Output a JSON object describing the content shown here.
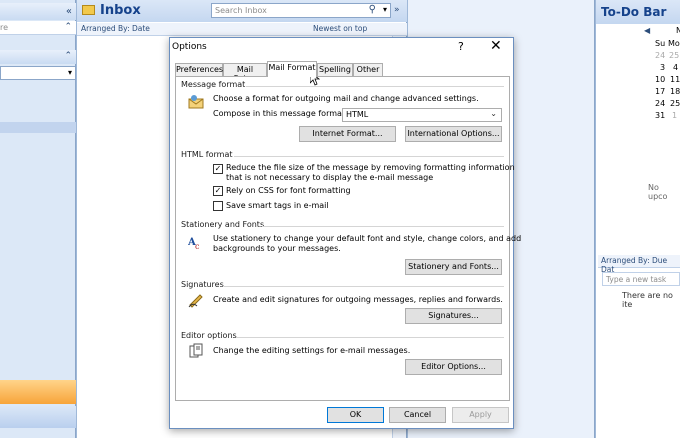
{
  "nav": {
    "collapse_glyph": "«",
    "row1_text": "re",
    "row1_chevron": "⌃",
    "row2_chevron": "⌃",
    "dropdown_arrow": "▾"
  },
  "inbox": {
    "title": "Inbox",
    "search_placeholder": "Search Inbox",
    "search_icon": "⚲",
    "search_dd": "▾",
    "expand": "»",
    "arranged_by": "Arranged By: Date",
    "sort_order": "Newest on top",
    "scroll_up": "▲"
  },
  "todo": {
    "title": "To-Do Bar",
    "prev": "◀",
    "month_label": "N",
    "weekday_headers": [
      "Su",
      "Mo"
    ],
    "calendar_rows": [
      [
        "24",
        "25"
      ],
      [
        "3",
        "4"
      ],
      [
        "10",
        "11"
      ],
      [
        "17",
        "18"
      ],
      [
        "24",
        "25"
      ],
      [
        "31",
        "1"
      ]
    ],
    "no_upcoming": "No upco",
    "arranged_by": "Arranged By: Due Dat",
    "new_task_placeholder": "Type a new task",
    "no_items": "There are no ite"
  },
  "dialog": {
    "title": "Options",
    "help_glyph": "?",
    "close_glyph": "✕",
    "tabs": [
      "Preferences",
      "Mail Setup",
      "Mail Format",
      "Spelling",
      "Other"
    ],
    "active_tab": "Mail Format",
    "sections": {
      "message_format": {
        "title": "Message format",
        "description": "Choose a format for outgoing mail and change advanced settings.",
        "compose_label": "Compose in this message format:",
        "compose_value": "HTML",
        "internet_format_button": "Internet Format...",
        "international_options_button": "International Options..."
      },
      "html_format": {
        "title": "HTML format",
        "reduce_size_line1": "Reduce the file size of the message by removing formatting information",
        "reduce_size_line2": "that is not necessary to display the e-mail message",
        "reduce_size_checked": true,
        "rely_css": "Rely on CSS for font formatting",
        "rely_css_checked": true,
        "smart_tags": "Save smart tags in e-mail",
        "smart_tags_checked": false,
        "check_glyph": "✓"
      },
      "stationery": {
        "title": "Stationery and Fonts",
        "description_line1": "Use stationery to change your default font and style, change colors, and add",
        "description_line2": "backgrounds to your messages.",
        "button": "Stationery and Fonts..."
      },
      "signatures": {
        "title": "Signatures",
        "description": "Create and edit signatures for outgoing messages, replies and forwards.",
        "button": "Signatures..."
      },
      "editor": {
        "title": "Editor options",
        "description": "Change the editing settings for e-mail messages.",
        "button": "Editor Options..."
      }
    },
    "footer": {
      "ok": "OK",
      "cancel": "Cancel",
      "apply": "Apply"
    }
  },
  "colors": {
    "outlook_blue": "#15428b",
    "accent_border": "#0078d7"
  }
}
